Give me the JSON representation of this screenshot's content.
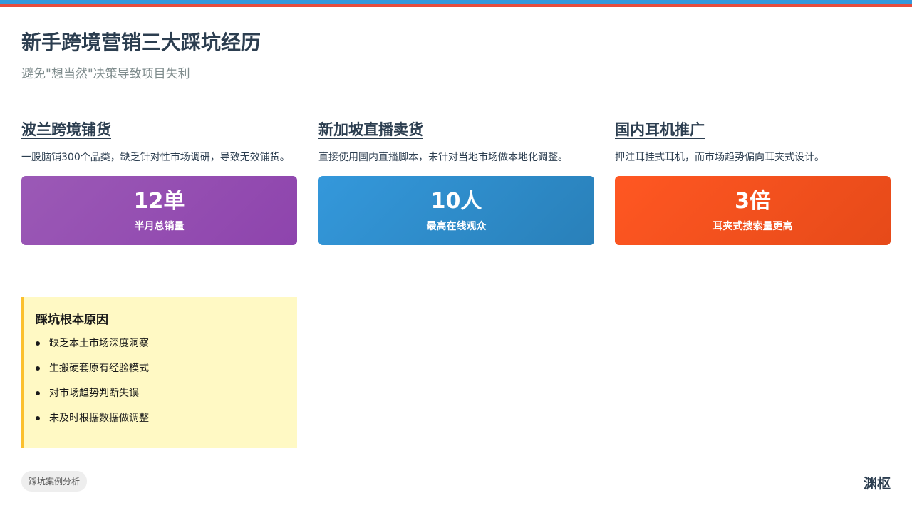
{
  "header": {
    "title": "新手跨境营销三大踩坑经历",
    "subtitle": "避免\"想当然\"决策导致项目失利"
  },
  "cases": [
    {
      "title": "波兰跨境铺货",
      "description": "一股脑铺300个品类，缺乏针对性市场调研，导致无效铺货。",
      "stat_value": "12单",
      "stat_label": "半月总销量",
      "color": "#8e44ad"
    },
    {
      "title": "新加坡直播卖货",
      "description": "直接使用国内直播脚本，未针对当地市场做本地化调整。",
      "stat_value": "10人",
      "stat_label": "最高在线观众",
      "color": "#2980b9"
    },
    {
      "title": "国内耳机推广",
      "description": "押注耳挂式耳机，而市场趋势偏向耳夹式设计。",
      "stat_value": "3倍",
      "stat_label": "耳夹式搜索量更高",
      "color": "#e64a19"
    }
  ],
  "reasons": {
    "title": "踩坑根本原因",
    "items": [
      "缺乏本土市场深度洞察",
      "生搬硬套原有经验模式",
      "对市场趋势判断失误",
      "未及时根据数据做调整"
    ]
  },
  "footer": {
    "tag": "踩坑案例分析",
    "brand": "渊枢"
  },
  "colors": {
    "accent_blue": "#3498db",
    "accent_red": "#e74c3c",
    "highlight_bg": "#fff9c4",
    "highlight_border": "#fbc02d"
  }
}
